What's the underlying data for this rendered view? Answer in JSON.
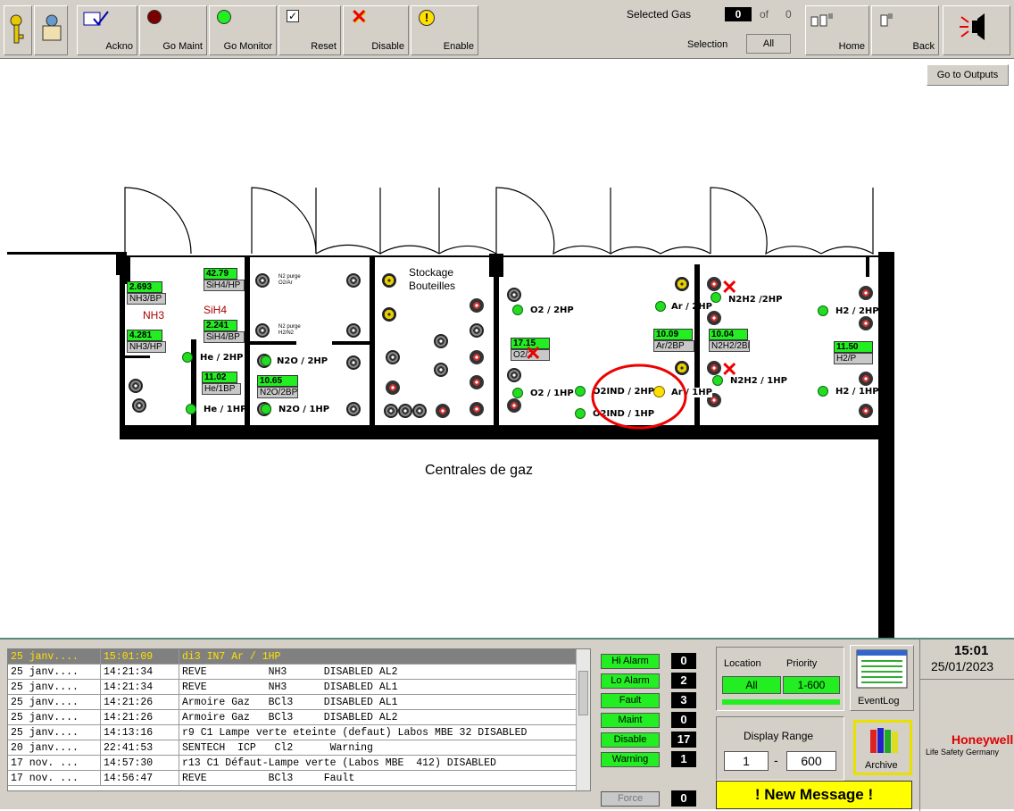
{
  "toolbar": {
    "ack_label": "Ackno",
    "go_maint_label": "Go Maint",
    "go_monitor_label": "Go Monitor",
    "reset_label": "Reset",
    "disable_label": "Disable",
    "enable_label": "Enable",
    "selected_gas_label": "Selected Gas",
    "selected_gas_value": "0",
    "of_label": "of",
    "of_value": "0",
    "selection_label": "Selection",
    "all_label": "All",
    "home_label": "Home",
    "back_label": "Back",
    "go_outputs_label": "Go to Outputs"
  },
  "map": {
    "caption": "Centrales de gaz",
    "stockage_label": "Stockage\nBouteilles",
    "nh3_room": "NH3",
    "sih4_room": "SiH4",
    "n2_purge_1": "N2 purge\nO2/Ar",
    "n2_purge_2": "N2 purge\nH2/N2",
    "values": [
      {
        "value": "2.693",
        "tag": "NH3/BP"
      },
      {
        "value": "4.281",
        "tag": "NH3/HP"
      },
      {
        "value": "42.79",
        "tag": "SiH4/HP"
      },
      {
        "value": "2.241",
        "tag": "SiH4/BP"
      },
      {
        "value": "11.02",
        "tag": "He/1BP"
      },
      {
        "value": "10.65",
        "tag": "N2O/2BP"
      },
      {
        "value": "17.15",
        "tag": "O2/2"
      },
      {
        "value": "10.09",
        "tag": "Ar/2BP"
      },
      {
        "value": "10.04",
        "tag": "N2H2/2BP"
      },
      {
        "value": "11.50",
        "tag": "H2/P"
      }
    ],
    "labels": {
      "he2": "He / 2HP",
      "he1": "He / 1HP",
      "n2o2": "N2O / 2HP",
      "n2o1": "N2O / 1HP",
      "o2_2": "O2 / 2HP",
      "o2_1": "O2 / 1HP",
      "o2ind2": "O2IND / 2HP",
      "o2ind1": "O2IND / 1HP",
      "ar2": "Ar / 2HP",
      "ar1": "Ar / 1HP",
      "n2h2_2": "N2H2 /2HP",
      "n2h2_1": "N2H2 / 1HP",
      "h2_2": "H2 / 2HP",
      "h2_1": "H2 / 1HP"
    }
  },
  "log": {
    "rows": [
      {
        "date": "25 janv....",
        "time": "15:01:09",
        "msg": "di3 IN7 Ar / 1HP",
        "selected": true
      },
      {
        "date": "25 janv....",
        "time": "14:21:34",
        "msg": "REVE          NH3      DISABLED AL2"
      },
      {
        "date": "25 janv....",
        "time": "14:21:34",
        "msg": "REVE          NH3      DISABLED AL1"
      },
      {
        "date": "25 janv....",
        "time": "14:21:26",
        "msg": "Armoire Gaz   BCl3     DISABLED AL1"
      },
      {
        "date": "25 janv....",
        "time": "14:21:26",
        "msg": "Armoire Gaz   BCl3     DISABLED AL2"
      },
      {
        "date": "25 janv....",
        "time": "14:13:16",
        "msg": "r9 C1 Lampe verte eteinte (defaut) Labos MBE 32 DISABLED"
      },
      {
        "date": "20 janv....",
        "time": "22:41:53",
        "msg": "SENTECH  ICP   Cl2      Warning"
      },
      {
        "date": "17 nov. ...",
        "time": "14:57:30",
        "msg": "r13 C1 Défaut-Lampe verte (Labos MBE  412) DISABLED"
      },
      {
        "date": "17 nov. ...",
        "time": "14:56:47",
        "msg": "REVE          BCl3     Fault"
      }
    ]
  },
  "status": {
    "hi_alarm": {
      "label": "Hi Alarm",
      "count": "0"
    },
    "lo_alarm": {
      "label": "Lo Alarm",
      "count": "2"
    },
    "fault": {
      "label": "Fault",
      "count": "3"
    },
    "maint": {
      "label": "Maint",
      "count": "0"
    },
    "disable": {
      "label": "Disable",
      "count": "17"
    },
    "warning": {
      "label": "Warning",
      "count": "1"
    },
    "force": {
      "label": "Force",
      "count": "0"
    }
  },
  "filter": {
    "location_label": "Location",
    "priority_label": "Priority",
    "location_value": "All",
    "priority_value": "1-600",
    "display_range_label": "Display Range",
    "range_from": "1",
    "range_sep": "-",
    "range_to": "600",
    "new_message": "! New Message !"
  },
  "right_panel": {
    "eventlog_label": "EventLog",
    "archive_label": "Archive",
    "time": "15:01",
    "date": "25/01/2023",
    "brand": "Honeywell",
    "brand_sub": "Life Safety Germany"
  },
  "colors": {
    "value_green": "#22ee22",
    "alarm_red": "#ee0000",
    "highlight_yellow": "#ffff00"
  }
}
